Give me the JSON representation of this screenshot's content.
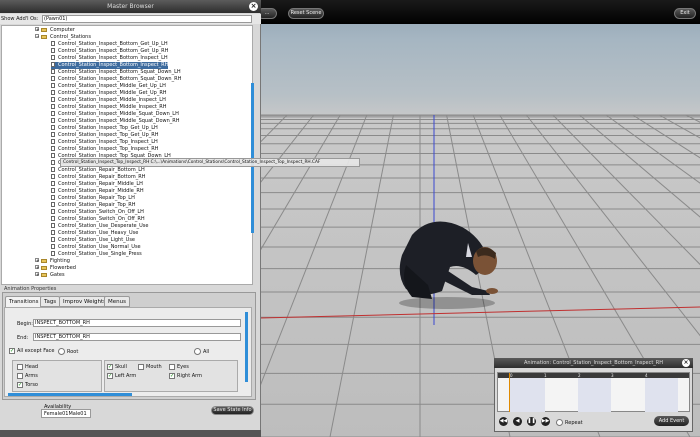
{
  "app": {
    "top_buttons": [
      "...",
      "Reset Scene"
    ],
    "exit_label": "Exit"
  },
  "browser": {
    "title": "Master Browser",
    "close": "×",
    "filter_label": "Show Add'l Os:",
    "filter_value": "(Pawn01)",
    "tree": [
      {
        "t": "folder",
        "label": "Computer",
        "expanded": false
      },
      {
        "t": "folder",
        "label": "Control_Stations",
        "expanded": true
      },
      {
        "t": "file",
        "label": "Control_Station_Inspect_Bottom_Get_Up_LH"
      },
      {
        "t": "file",
        "label": "Control_Station_Inspect_Bottom_Get_Up_RH"
      },
      {
        "t": "file",
        "label": "Control_Station_Inspect_Bottom_Inspect_LH"
      },
      {
        "t": "file",
        "label": "Control_Station_Inspect_Bottom_Inspect_RH",
        "selected": true
      },
      {
        "t": "file",
        "label": "Control_Station_Inspect_Bottom_Squat_Down_LH"
      },
      {
        "t": "file",
        "label": "Control_Station_Inspect_Bottom_Squat_Down_RH"
      },
      {
        "t": "file",
        "label": "Control_Station_Inspect_Middle_Get_Up_LH"
      },
      {
        "t": "file",
        "label": "Control_Station_Inspect_Middle_Get_Up_RH"
      },
      {
        "t": "file",
        "label": "Control_Station_Inspect_Middle_Inspect_LH"
      },
      {
        "t": "file",
        "label": "Control_Station_Inspect_Middle_Inspect_RH"
      },
      {
        "t": "file",
        "label": "Control_Station_Inspect_Middle_Squat_Down_LH"
      },
      {
        "t": "file",
        "label": "Control_Station_Inspect_Middle_Squat_Down_RH"
      },
      {
        "t": "file",
        "label": "Control_Station_Inspect_Top_Get_Up_LH"
      },
      {
        "t": "file",
        "label": "Control_Station_Inspect_Top_Get_Up_RH"
      },
      {
        "t": "file",
        "label": "Control_Station_Inspect_Top_Inspect_LH"
      },
      {
        "t": "file",
        "label": "Control_Station_Inspect_Top_Inspect_RH"
      },
      {
        "t": "file",
        "label": "Control_Station_Inspect_Top_Squat_Down_LH"
      },
      {
        "t": "file",
        "label": "Control_Station_Inspect_Top_Squat_Down_RH"
      },
      {
        "t": "file",
        "label": "Control_Station_Repair_Bottom_LH"
      },
      {
        "t": "file",
        "label": "Control_Station_Repair_Bottom_RH"
      },
      {
        "t": "file",
        "label": "Control_Station_Repair_Middle_LH"
      },
      {
        "t": "file",
        "label": "Control_Station_Repair_Middle_RH"
      },
      {
        "t": "file",
        "label": "Control_Station_Repair_Top_LH"
      },
      {
        "t": "file",
        "label": "Control_Station_Repair_Top_RH"
      },
      {
        "t": "file",
        "label": "Control_Station_Switch_On_Off_LH"
      },
      {
        "t": "file",
        "label": "Control_Station_Switch_On_Off_RH"
      },
      {
        "t": "file",
        "label": "Control_Station_Use_Desperate_Use"
      },
      {
        "t": "file",
        "label": "Control_Station_Use_Heavy_Use"
      },
      {
        "t": "file",
        "label": "Control_Station_Use_Light_Use"
      },
      {
        "t": "file",
        "label": "Control_Station_Use_Normal_Use"
      },
      {
        "t": "file",
        "label": "Control_Station_Use_Single_Press"
      },
      {
        "t": "folder",
        "label": "Fighting",
        "expanded": false
      },
      {
        "t": "folder",
        "label": "Flowerbed",
        "expanded": false
      },
      {
        "t": "folder",
        "label": "Gates",
        "expanded": false
      }
    ],
    "tooltip": "Control_Station_Inspect_Top_Inspect_RH  C:\\...\\Animations\\Control_Stations\\Control_Station_Inspect_Top_Inspect_RH.CAF"
  },
  "props": {
    "label": "Animation Properties",
    "tabs": [
      "Transitions",
      "Tags",
      "Improv Weights",
      "Menus"
    ],
    "begin_label": "Begin:",
    "begin_value": "INSPECT_BOTTOM_RH",
    "end_label": "End:",
    "end_value": "INSPECT_BOTTOM_RH",
    "all_except_face": "All except Face",
    "root": "Root",
    "all": "All",
    "head": "Head",
    "arms": "Arms",
    "torso": "Torso",
    "skull": "Skull",
    "mouth": "Mouth",
    "eyes": "Eyes",
    "left_arm": "Left Arm",
    "right_arm": "Right Arm",
    "check": "✓"
  },
  "availability": {
    "label": "Availability",
    "value": "Female01Male01"
  },
  "save_label": "Save State Info",
  "anim": {
    "title": "Animation: Control_Station_Inspect_Bottom_Inspect_RH",
    "ticks": [
      "0",
      "1",
      "2",
      "3",
      "4"
    ],
    "repeat": "Repeat",
    "add_event": "Add Event"
  }
}
